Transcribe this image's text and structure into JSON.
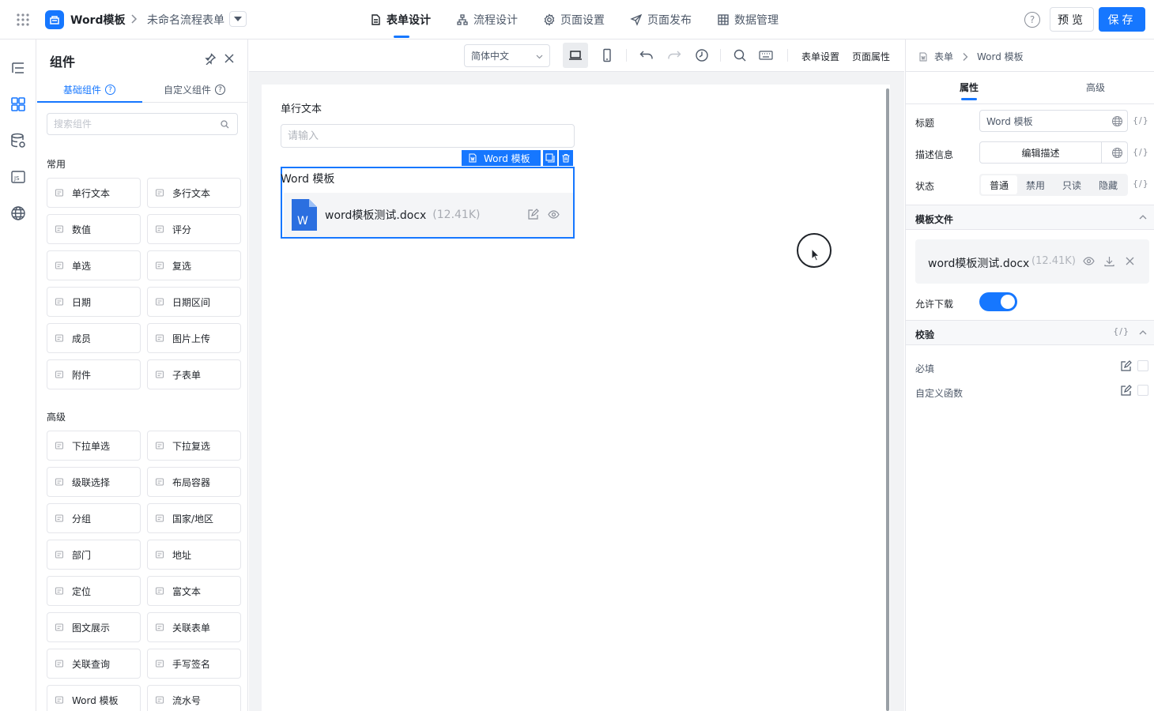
{
  "topbar": {
    "app_name": "Word模板",
    "form_name": "未命名流程表单",
    "tabs": [
      {
        "label": "表单设计",
        "icon": "form-icon",
        "active": true
      },
      {
        "label": "流程设计",
        "icon": "flow-icon"
      },
      {
        "label": "页面设置",
        "icon": "gear-icon"
      },
      {
        "label": "页面发布",
        "icon": "send-icon"
      },
      {
        "label": "数据管理",
        "icon": "table-icon"
      }
    ],
    "help_label": "?",
    "preview_label": "预览",
    "save_label": "保存",
    "accent_color": "#1677ff"
  },
  "component_panel": {
    "title": "组件",
    "tabs": [
      {
        "label": "基础组件",
        "active": true
      },
      {
        "label": "自定义组件"
      }
    ],
    "search_placeholder": "搜索组件",
    "sections": [
      {
        "title": "常用",
        "items": [
          {
            "label": "单行文本",
            "icon": "single-line-icon"
          },
          {
            "label": "多行文本",
            "icon": "multi-line-icon"
          },
          {
            "label": "数值",
            "icon": "number-icon"
          },
          {
            "label": "评分",
            "icon": "star-icon"
          },
          {
            "label": "单选",
            "icon": "radio-icon"
          },
          {
            "label": "复选",
            "icon": "checkbox-icon"
          },
          {
            "label": "日期",
            "icon": "calendar-icon"
          },
          {
            "label": "日期区间",
            "icon": "date-range-icon"
          },
          {
            "label": "成员",
            "icon": "user-icon"
          },
          {
            "label": "图片上传",
            "icon": "image-icon"
          },
          {
            "label": "附件",
            "icon": "paperclip-icon"
          },
          {
            "label": "子表单",
            "icon": "subform-icon"
          }
        ]
      },
      {
        "title": "高级",
        "items": [
          {
            "label": "下拉单选",
            "icon": "dropdown-icon"
          },
          {
            "label": "下拉复选",
            "icon": "dropdown-multi-icon"
          },
          {
            "label": "级联选择",
            "icon": "cascade-icon"
          },
          {
            "label": "布局容器",
            "icon": "layout-icon"
          },
          {
            "label": "分组",
            "icon": "group-icon"
          },
          {
            "label": "国家/地区",
            "icon": "globe-icon"
          },
          {
            "label": "部门",
            "icon": "department-icon"
          },
          {
            "label": "地址",
            "icon": "map-icon"
          },
          {
            "label": "定位",
            "icon": "location-icon"
          },
          {
            "label": "富文本",
            "icon": "rich-text-icon"
          },
          {
            "label": "图文展示",
            "icon": "image-text-icon"
          },
          {
            "label": "关联表单",
            "icon": "link-form-icon"
          },
          {
            "label": "关联查询",
            "icon": "query-icon"
          },
          {
            "label": "手写签名",
            "icon": "pen-icon"
          },
          {
            "label": "Word 模板",
            "icon": "word-icon"
          },
          {
            "label": "流水号",
            "icon": "serial-icon"
          }
        ]
      }
    ]
  },
  "canvas": {
    "toolbar": {
      "language": "简体中文",
      "form_settings_label": "表单设置",
      "page_props_label": "页面属性"
    },
    "text_field": {
      "label": "单行文本",
      "placeholder": "请输入"
    },
    "selected_tag": "Word 模板",
    "word_field": {
      "label": "Word 模板",
      "file_name": "word模板测试.docx",
      "file_size": "(12.41K)",
      "file_badge": "W"
    }
  },
  "properties": {
    "breadcrumb": [
      "表单",
      "Word 模板"
    ],
    "tabs": [
      {
        "label": "属性",
        "active": true
      },
      {
        "label": "高级"
      }
    ],
    "fx_label": "{/}",
    "title_label": "标题",
    "title_value": "Word 模板",
    "desc_label": "描述信息",
    "desc_button": "编辑描述",
    "state_label": "状态",
    "state_options": [
      {
        "label": "普通",
        "active": true
      },
      {
        "label": "禁用"
      },
      {
        "label": "只读"
      },
      {
        "label": "隐藏"
      }
    ],
    "template_section": "模板文件",
    "template_file": {
      "name": "word模板测试.docx",
      "size": "(12.41K)"
    },
    "allow_download_label": "允许下载",
    "allow_download": true,
    "validation_section": "校验",
    "validation_rows": [
      {
        "label": "必填"
      },
      {
        "label": "自定义函数"
      }
    ]
  }
}
